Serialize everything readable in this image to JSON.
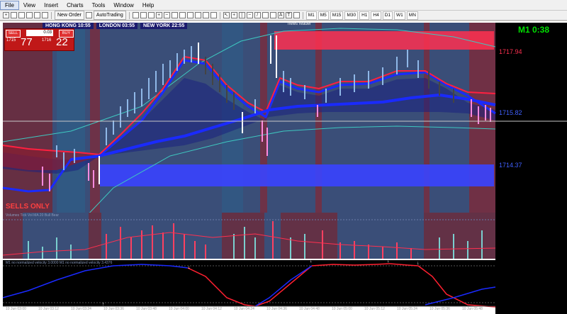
{
  "menu": [
    "File",
    "View",
    "Insert",
    "Charts",
    "Tools",
    "Window",
    "Help"
  ],
  "toolbar": {
    "new_order": "New Order",
    "autotrading": "AutoTrading",
    "timeframes": [
      "M1",
      "M5",
      "M15",
      "M30",
      "H1",
      "H4",
      "D1",
      "W1",
      "MN"
    ]
  },
  "sessions": {
    "hong_kong": "HONG KONG 10:55",
    "london": "LONDON  03:55",
    "new_york": "NEW YORK  22:55"
  },
  "news_reader": "news reader",
  "trade_panel": {
    "sell_label": "SELL",
    "buy_label": "BUY",
    "lot": "0.03",
    "sell_prefix": "1715",
    "sell_big": "77",
    "buy_prefix": "1716",
    "buy_big": "22"
  },
  "timer": "M1  0:38",
  "price_labels": {
    "upper": "1717.94",
    "middle": "1715.82",
    "lower": "1714.37"
  },
  "sells_only": "SELLS ONLY",
  "indicator_titles": {
    "volume": "Volumes  Tick Vol  MA 20  Bull  Bear",
    "velocity": "M1 no normalized velocity 3.0000  M1 no normalized velocity 3.4376"
  },
  "time_axis": [
    "10 Jun 03:00",
    "10 Jun 03:12",
    "10 Jun 03:24",
    "10 Jun 03:36",
    "10 Jun 03:48",
    "10 Jun 04:00",
    "10 Jun 04:12",
    "10 Jun 04:24",
    "10 Jun 04:36",
    "10 Jun 04:48",
    "10 Jun 05:00",
    "10 Jun 05:12",
    "10 Jun 05:24",
    "10 Jun 05:36",
    "10 Jun 05:48"
  ],
  "colors": {
    "chart_bg": "#3a4e78",
    "red_zone": "#6e2a3a",
    "blue_band": "#3a44ff",
    "red_band": "#ff3050",
    "ma_blue": "#1a2aff",
    "ma_red": "#ff2040",
    "teal": "#3ec8c0",
    "timer": "#00e000"
  }
}
